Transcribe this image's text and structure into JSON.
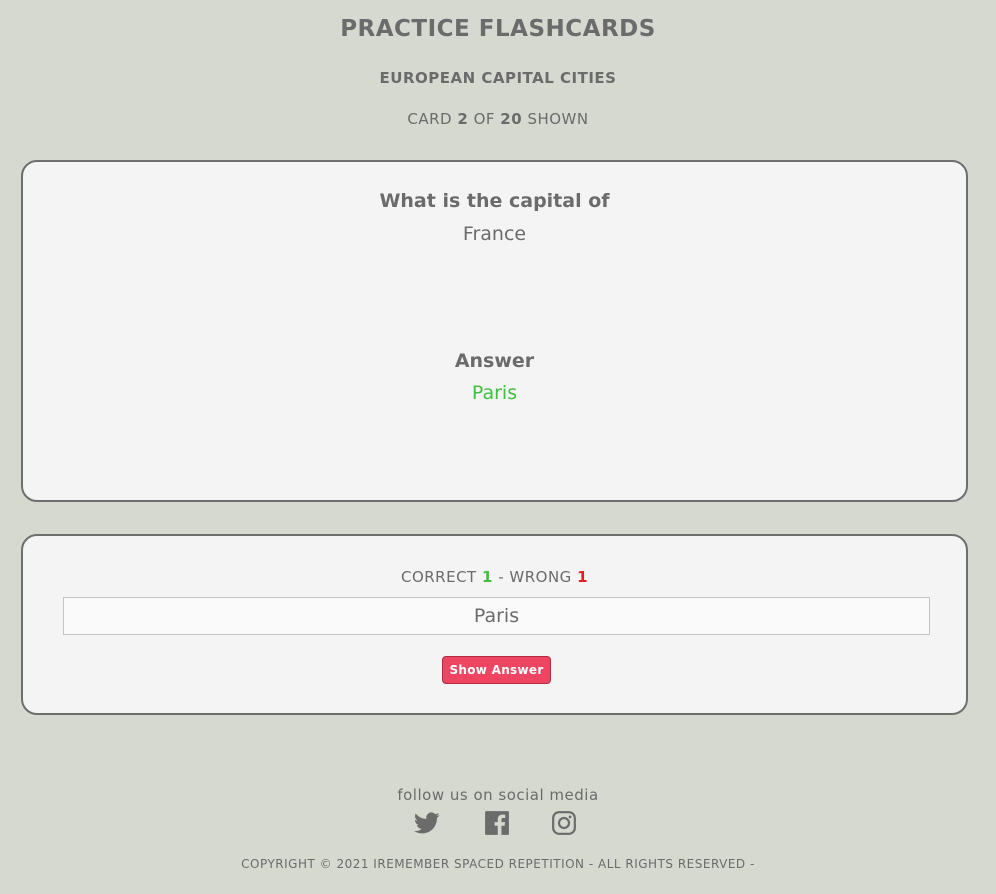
{
  "header": {
    "title": "PRACTICE FLASHCARDS",
    "deck": "EUROPEAN CAPITAL CITIES",
    "card_prefix": "CARD",
    "card_current": "2",
    "card_of": "OF",
    "card_total": "20",
    "card_suffix": "SHOWN"
  },
  "card": {
    "question_label": "What is the capital of",
    "question_value": "France",
    "answer_label": "Answer",
    "answer_value": "Paris",
    "answer_color": "#3fbf3f"
  },
  "answer_box": {
    "correct_label": "CORRECT",
    "correct_count": "1",
    "separator": "- WRONG",
    "wrong_count": "1",
    "input_value": "Paris",
    "button_label": "Show Answer",
    "button_color": "#ee4563"
  },
  "footer": {
    "follow_text": "follow us on social media",
    "social_icons": [
      "twitter-icon",
      "facebook-icon",
      "instagram-icon"
    ],
    "copyright": "COPYRIGHT © 2021 IREMEMBER SPACED REPETITION - ALL RIGHTS RESERVED -"
  }
}
